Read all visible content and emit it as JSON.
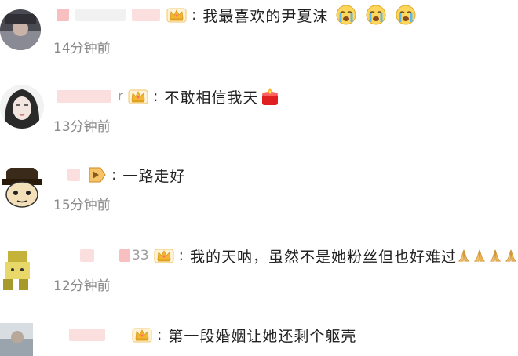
{
  "comments": [
    {
      "text": "我最喜欢的尹夏沫",
      "time": "14分钟前",
      "badge": "crown-badge-icon",
      "emoji": [
        "crying-face-emoji",
        "crying-face-emoji",
        "crying-face-emoji"
      ]
    },
    {
      "text": "不敢相信我天",
      "time": "13分钟前",
      "badge": "crown-badge-icon",
      "handle_tail": "r",
      "emoji": [
        "candle-emoji"
      ]
    },
    {
      "text": "一路走好",
      "time": "15分钟前",
      "badge": "folded-badge-icon",
      "emoji": []
    },
    {
      "text": "我的天呐，虽然不是她粉丝但也好难过",
      "time": "12分钟前",
      "badge": "crown-badge-icon",
      "handle_tail": "33",
      "emoji": [
        "praying-hands-emoji",
        "praying-hands-emoji",
        "praying-hands-emoji",
        "praying-hands-emoji"
      ]
    },
    {
      "text": "第一段婚姻让她还剩个躯壳",
      "time": "",
      "badge": "crown-badge-icon",
      "emoji": []
    }
  ],
  "colors": {
    "username_blur": "#f6b4b4",
    "timestamp": "#8a8a8a",
    "comment_text": "#222222",
    "crown": "#f2b632"
  }
}
